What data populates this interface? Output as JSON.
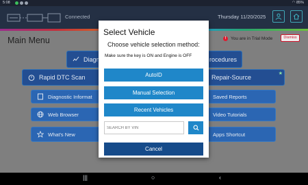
{
  "status_bar": {
    "time": "5:08",
    "battery": "85%"
  },
  "header": {
    "connection_status": "Connected",
    "date": "Thursday 11/20/2025"
  },
  "main": {
    "title": "Main Menu",
    "trial_notice": "You are in Trial Mode",
    "dismiss_label": "Dismiss",
    "tiles": {
      "diagnostics": "Diagn",
      "procedures": "rocedures",
      "rapid_dtc": "Rapid DTC Scan",
      "repair_source": "Repair-Source",
      "diagnostic_info": "Diagnostic Informat",
      "saved_reports": "Saved Reports",
      "web_browser": "Web Browser",
      "video_tutorials": "Video Tutorials",
      "whats_new": "What's New",
      "apps_shortcut": "Apps Shortcut"
    }
  },
  "dialog": {
    "title": "Select Vehicle",
    "subtitle": "Choose vehicle selection method:",
    "note": "Make sure the key is ON and Engine is OFF",
    "buttons": {
      "autoid": "AutoID",
      "manual": "Manual Selection",
      "recent": "Recent Vehicles",
      "cancel": "Cancel"
    },
    "vin_placeholder": "SEARCH BY VIN"
  },
  "colors": {
    "primary_button": "#1f87c9",
    "cancel_button": "#164b8a",
    "tile": "#2b66b3",
    "warning": "#e01b2f"
  }
}
